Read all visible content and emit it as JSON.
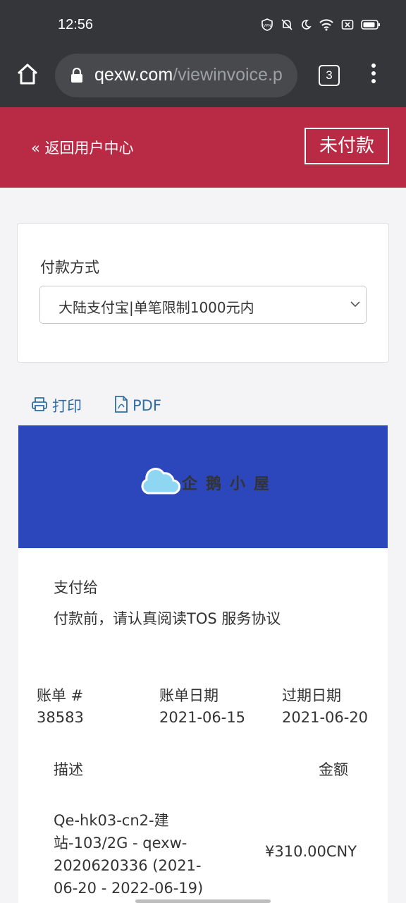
{
  "status_bar": {
    "time": "12:56",
    "icons": [
      "vpn-icon",
      "bell-off-icon",
      "moon-icon",
      "wifi-icon",
      "battery-x-icon",
      "battery-icon"
    ]
  },
  "browser": {
    "url_domain": "qexw.com",
    "url_path": "/viewinvoice.p",
    "tab_count": "3"
  },
  "header": {
    "back_link": "« 返回用户中心",
    "status_badge": "未付款",
    "colors": {
      "bar": "#b92b45"
    }
  },
  "payment": {
    "label": "付款方式",
    "selected": "大陆支付宝|单笔限制1000元内"
  },
  "actions": {
    "print": "打印",
    "pdf": "PDF"
  },
  "invoice": {
    "logo_text": "企鹅小屋",
    "banner_color": "#2c46bc",
    "pay_to": "支付给",
    "tos_notice": "付款前，请认真阅读TOS 服务协议",
    "meta": [
      {
        "label": "账单 #",
        "value": "38583"
      },
      {
        "label": "账单日期",
        "value": "2021-06-15"
      },
      {
        "label": "过期日期",
        "value": "2021-06-20"
      }
    ],
    "table": {
      "headers": {
        "description": "描述",
        "amount": "金额"
      },
      "rows": [
        {
          "description": "Qe-hk03-cn2-建站-103/2G - qexw-2020620336 (2021-06-20 - 2022-06-19)",
          "amount": "¥310.00CNY"
        }
      ]
    }
  }
}
